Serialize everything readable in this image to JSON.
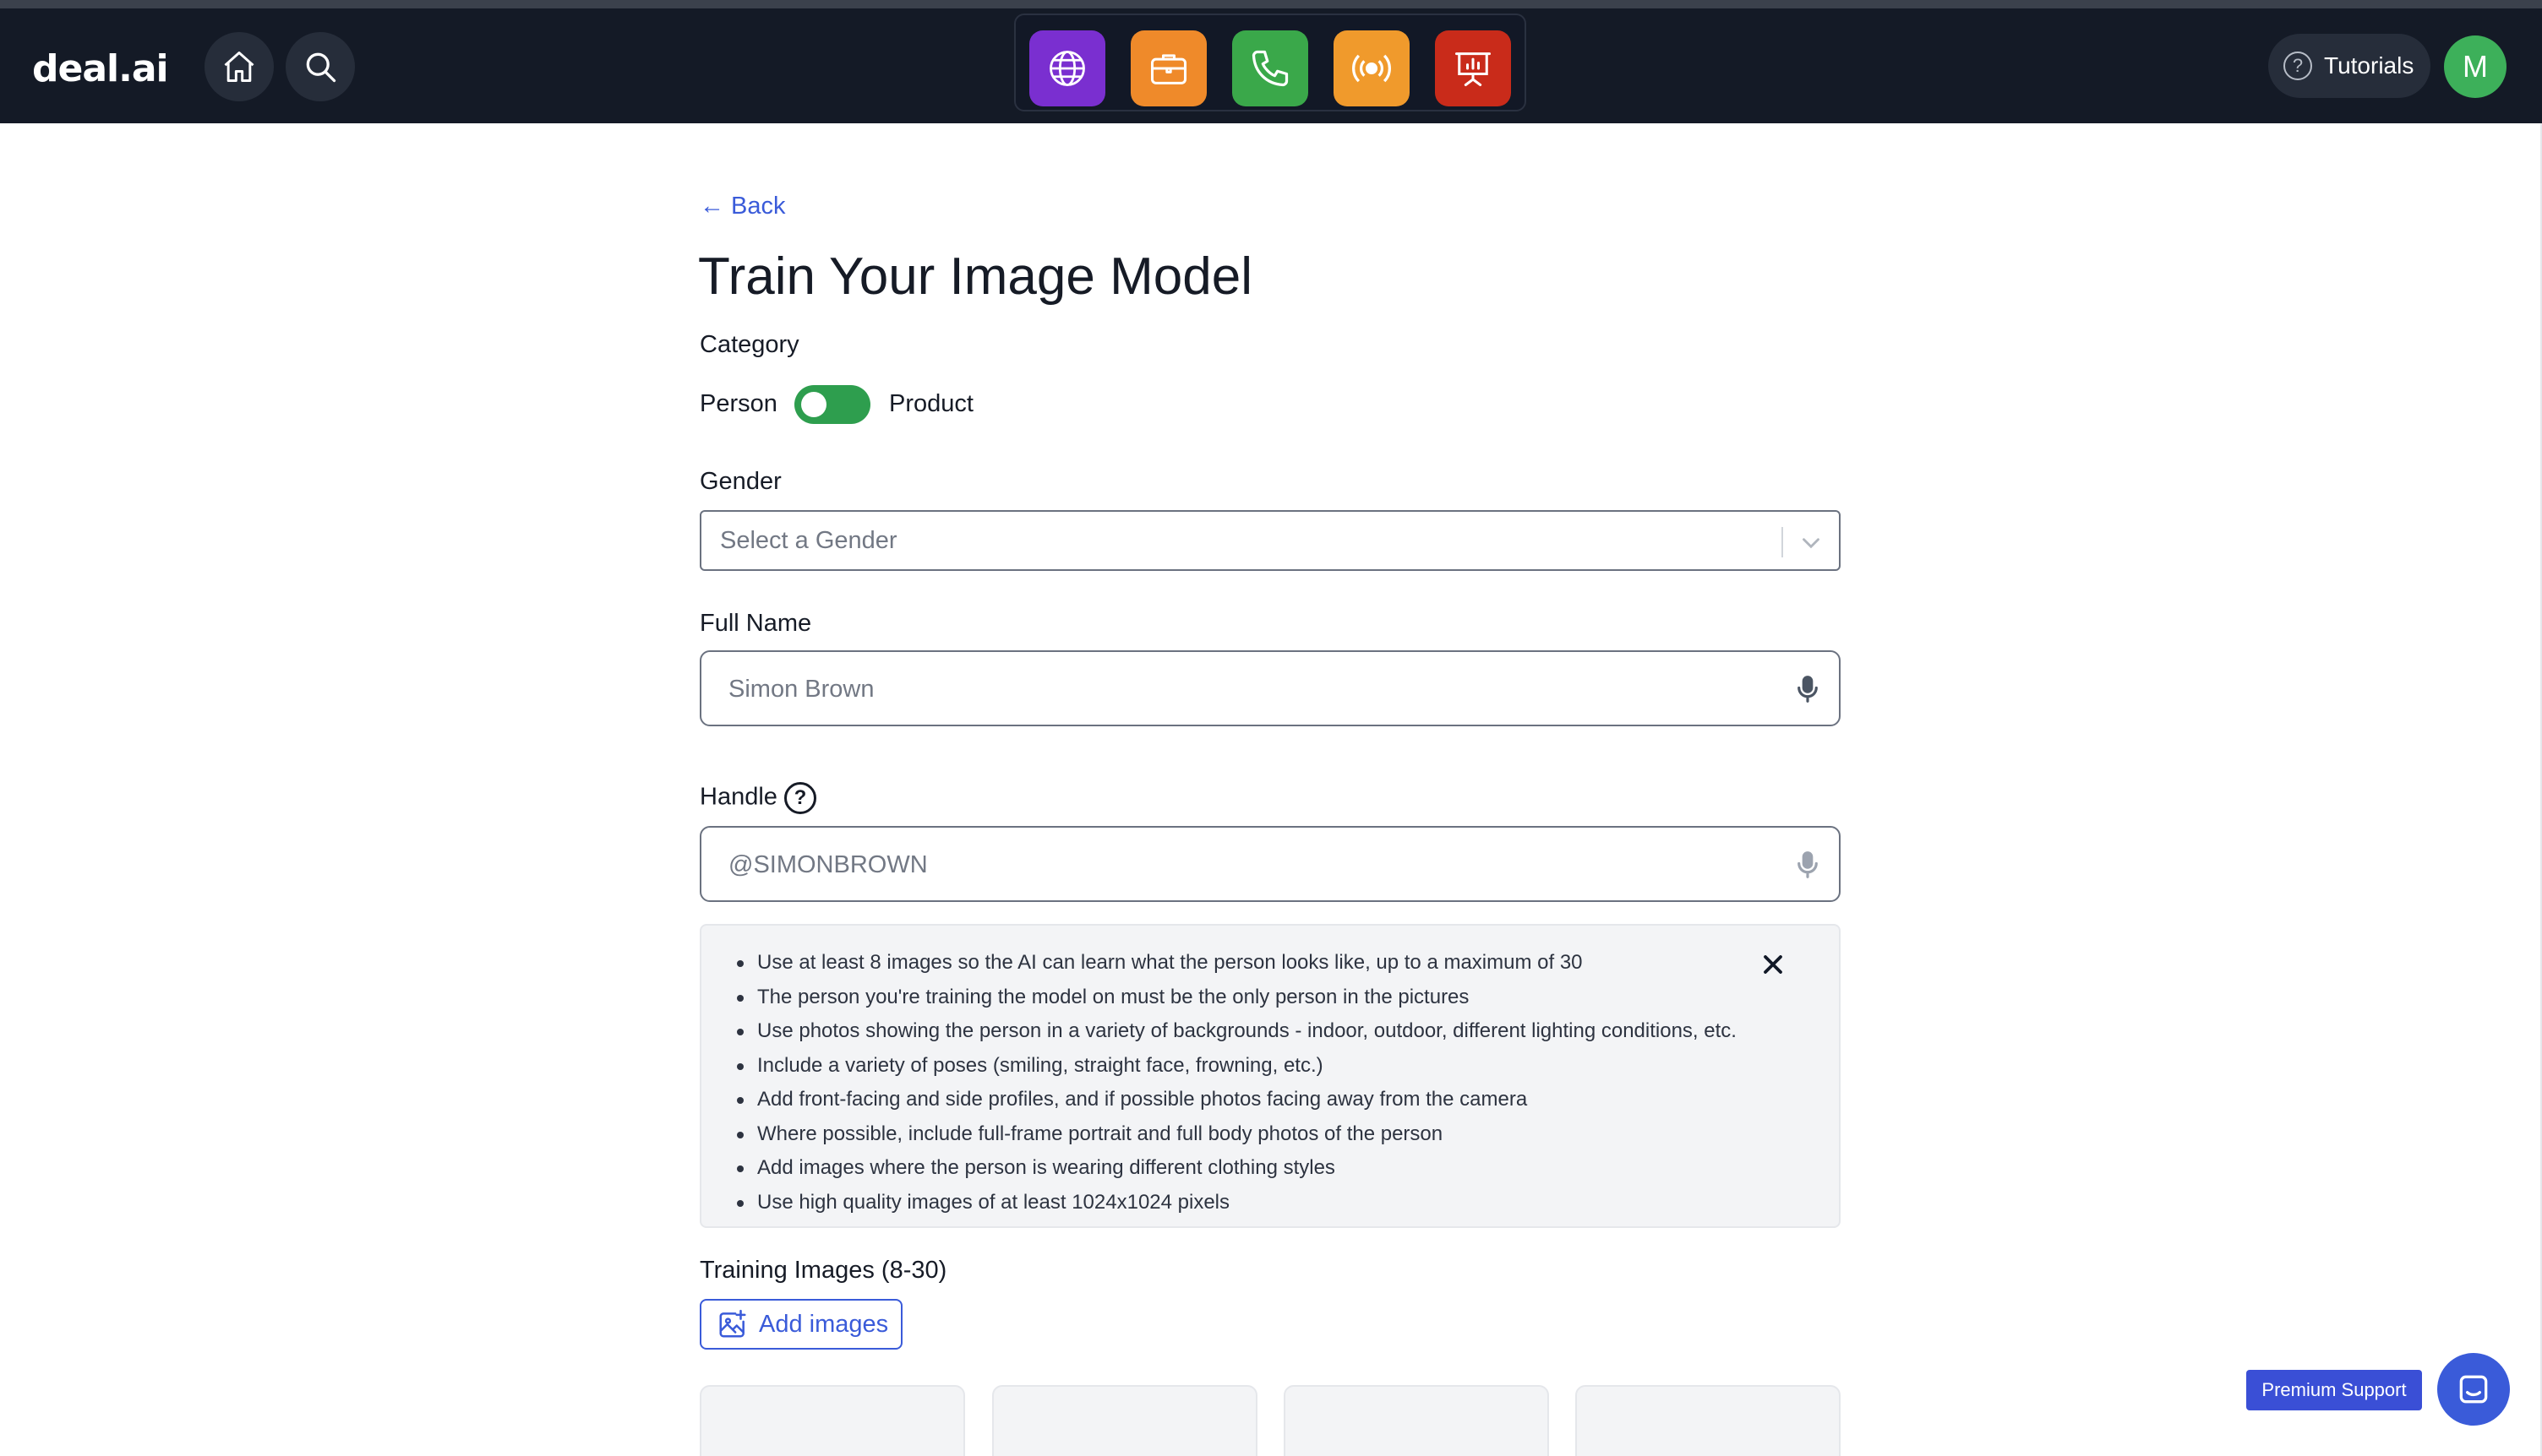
{
  "header": {
    "logo": "deal.ai",
    "apps": [
      {
        "name": "globe-app",
        "color": "#7a2fd0"
      },
      {
        "name": "briefcase-app",
        "color": "#ef8a2a"
      },
      {
        "name": "phone-app",
        "color": "#3aa84a"
      },
      {
        "name": "broadcast-app",
        "color": "#f09a2c"
      },
      {
        "name": "presentation-app",
        "color": "#c92b1a"
      }
    ],
    "tutorials_label": "Tutorials",
    "avatar_initial": "M"
  },
  "main": {
    "back_label": "← Back",
    "title": "Train Your Image Model",
    "category_label": "Category",
    "toggle_left": "Person",
    "toggle_right": "Product",
    "gender_label": "Gender",
    "gender_placeholder": "Select a Gender",
    "fullname_label": "Full Name",
    "fullname_value": "Simon Brown",
    "handle_label": "Handle",
    "handle_help": "?",
    "handle_value": "@SIMONBROWN",
    "tips": [
      "Use at least 8 images so the AI can learn what the person looks like, up to a maximum of 30",
      "The person you're training the model on must be the only person in the pictures",
      "Use photos showing the person in a variety of backgrounds - indoor, outdoor, different lighting conditions, etc.",
      "Include a variety of poses (smiling, straight face, frowning, etc.)",
      "Add front-facing and side profiles, and if possible photos facing away from the camera",
      "Where possible, include full-frame portrait and full body photos of the person",
      "Add images where the person is wearing different clothing styles",
      "Use high quality images of at least 1024x1024 pixels"
    ],
    "training_label": "Training Images (8-30)",
    "add_images_label": "Add images"
  },
  "support": {
    "premium_label": "Premium Support"
  },
  "colors": {
    "accent": "#3a5bd9",
    "toggle_on": "#2e9e4e",
    "header_bg": "#141a26"
  }
}
